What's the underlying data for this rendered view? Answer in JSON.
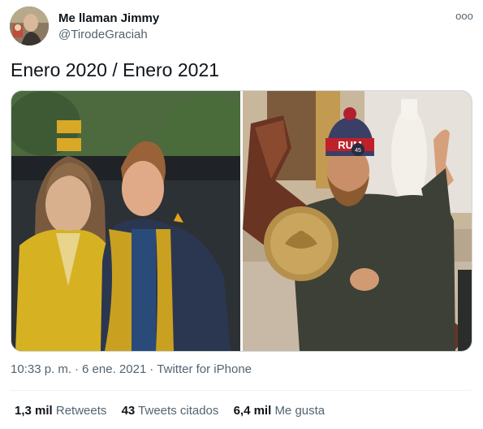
{
  "author": {
    "display_name": "Me llaman Jimmy",
    "handle": "@TirodeGraciah",
    "avatar_icon": "profile-photo"
  },
  "menu": {
    "more_icon": "more-options-icon",
    "more_glyph": "ooo"
  },
  "tweet": {
    "text": "Enero 2020 / Enero 2021",
    "time": "10:33 p. m.",
    "date": "6 ene. 2021",
    "separator": "·",
    "source": "Twitter for iPhone"
  },
  "media": {
    "images": [
      {
        "name": "photo-couple-yellow-scarves"
      },
      {
        "name": "photo-man-carrying-lectern"
      }
    ],
    "hat_text": "RUM",
    "badge_text": "45"
  },
  "stats": {
    "retweets": {
      "count": "1,3 mil",
      "label": "Retweets"
    },
    "quotes": {
      "count": "43",
      "label": "Tweets citados"
    },
    "likes": {
      "count": "6,4 mil",
      "label": "Me gusta"
    }
  },
  "colors": {
    "text_primary": "#0f1419",
    "text_secondary": "#536471",
    "border": "#cfd9de"
  }
}
